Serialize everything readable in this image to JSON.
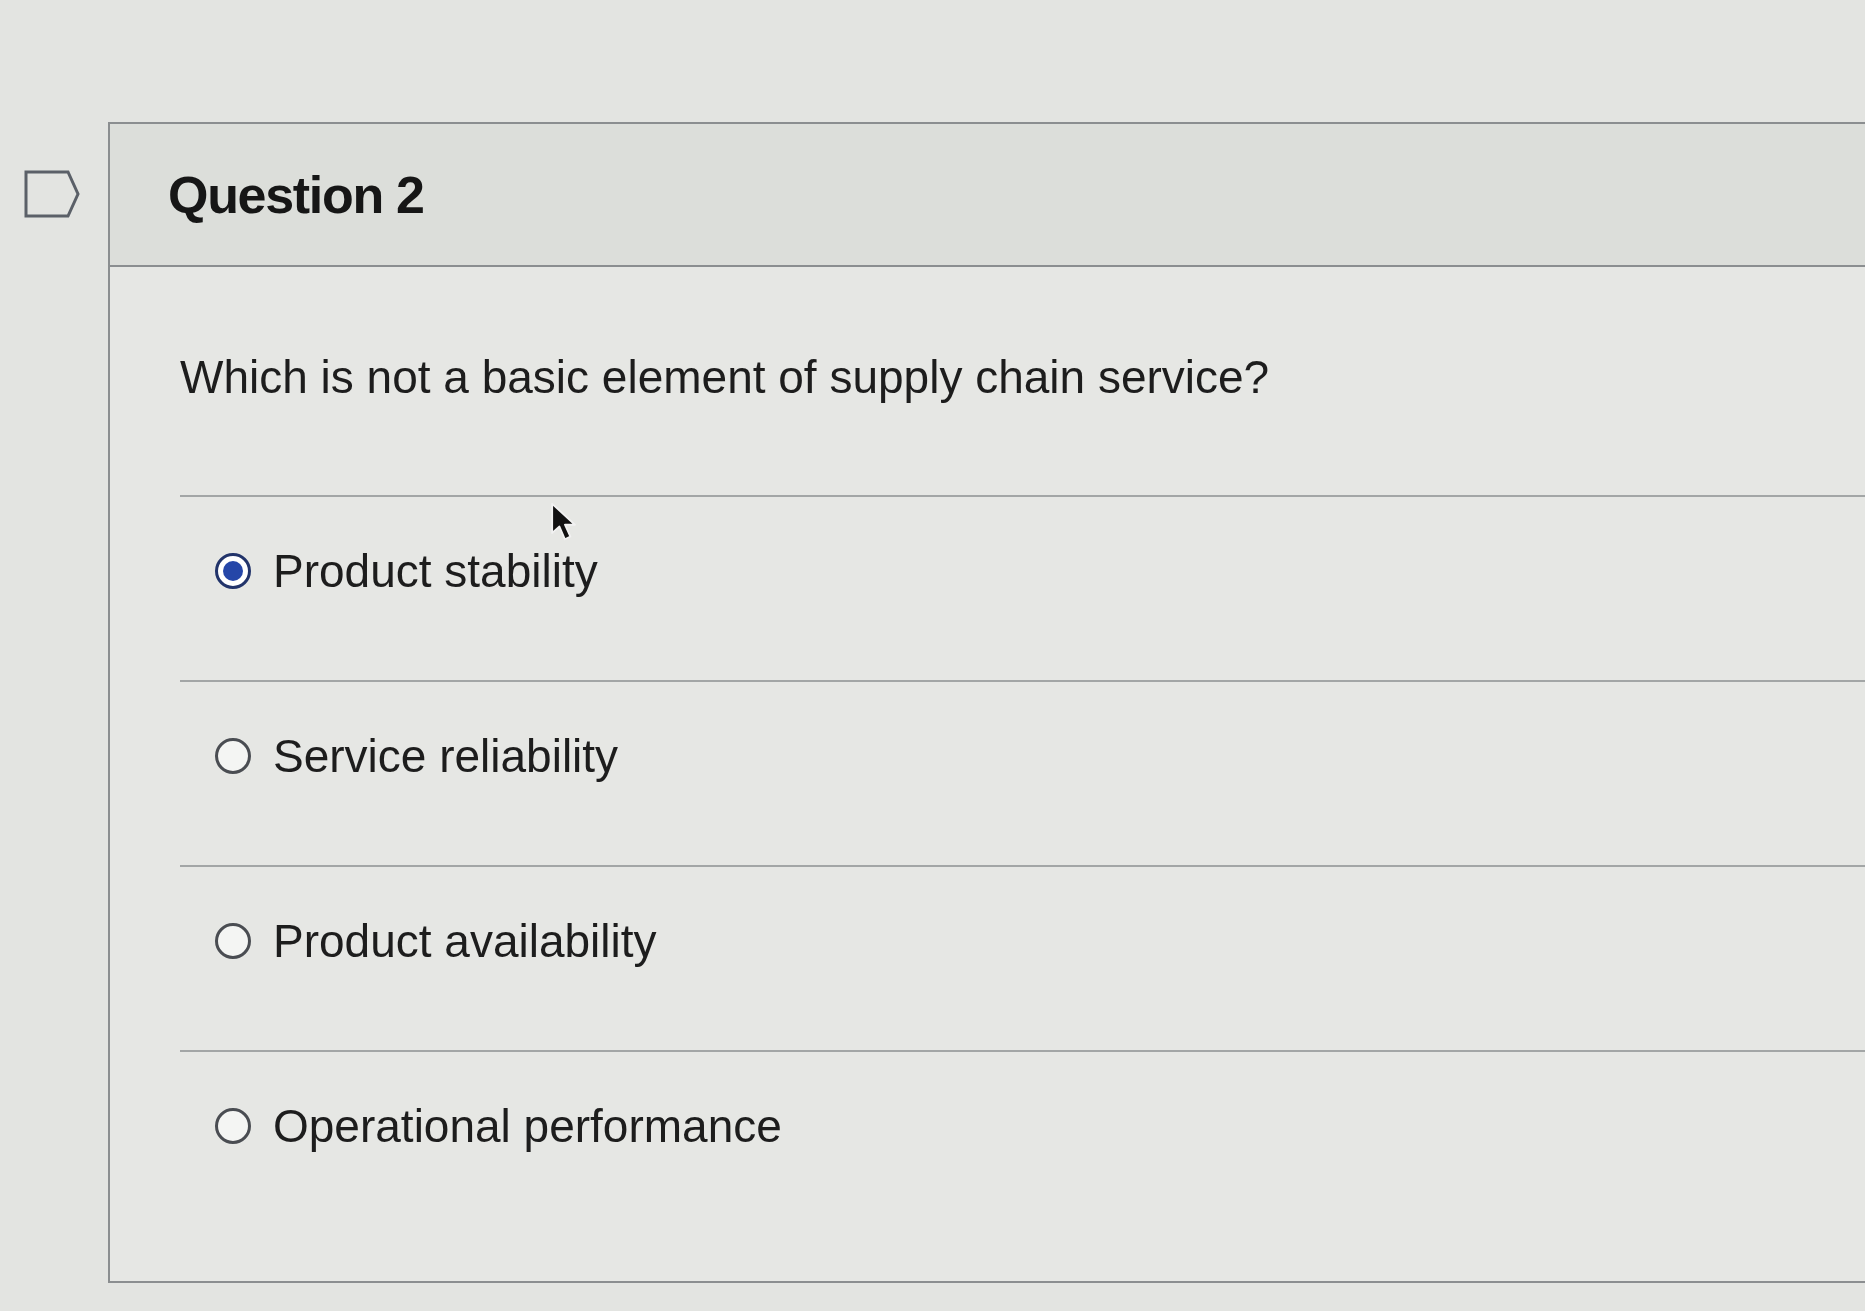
{
  "question": {
    "title": "Question 2",
    "prompt": "Which is not a basic element of supply chain service?",
    "options": [
      {
        "label": "Product stability",
        "selected": true
      },
      {
        "label": "Service reliability",
        "selected": false
      },
      {
        "label": "Product availability",
        "selected": false
      },
      {
        "label": "Operational performance",
        "selected": false
      }
    ]
  }
}
